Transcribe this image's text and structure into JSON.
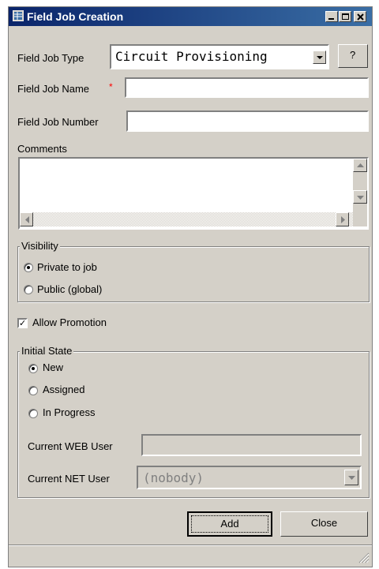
{
  "window": {
    "title": "Field Job Creation",
    "minimize_icon": "minimize-icon",
    "maximize_icon": "maximize-icon",
    "close_icon": "close-icon"
  },
  "form": {
    "field_job_type_label": "Field Job Type",
    "field_job_type_value": "Circuit Provisioning",
    "help_button": "?",
    "field_job_name_label": "Field Job Name",
    "required_marker": "*",
    "field_job_name_value": "",
    "field_job_number_label": "Field Job Number",
    "field_job_number_value": "",
    "comments_label": "Comments",
    "comments_value": ""
  },
  "visibility": {
    "legend": "Visibility",
    "options": [
      {
        "label": "Private to job",
        "selected": true
      },
      {
        "label": "Public (global)",
        "selected": false
      }
    ]
  },
  "allow_promotion": {
    "label": "Allow Promotion",
    "checked": true,
    "check_mark": "✓"
  },
  "initial_state": {
    "legend": "Initial State",
    "options": [
      {
        "label": "New",
        "selected": true
      },
      {
        "label": "Assigned",
        "selected": false
      },
      {
        "label": "In Progress",
        "selected": false
      }
    ],
    "web_user_label": "Current WEB User",
    "web_user_value": "",
    "net_user_label": "Current NET User",
    "net_user_value": "(nobody)"
  },
  "buttons": {
    "add": "Add",
    "close": "Close"
  },
  "colors": {
    "titlebar_start": "#0a246a",
    "titlebar_end": "#3a6ea5",
    "face": "#d4d0c8",
    "required": "#ff0000"
  }
}
